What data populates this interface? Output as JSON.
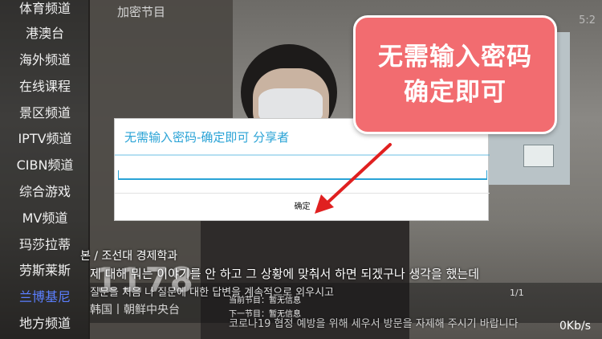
{
  "sidebar": {
    "items": [
      {
        "label": "体育频道"
      },
      {
        "label": "港澳台"
      },
      {
        "label": "海外频道"
      },
      {
        "label": "在线课程"
      },
      {
        "label": "景区频道"
      },
      {
        "label": "IPTV频道"
      },
      {
        "label": "CIBN频道"
      },
      {
        "label": "综合游戏"
      },
      {
        "label": "MV频道"
      },
      {
        "label": "玛莎拉蒂"
      },
      {
        "label": "劳斯莱斯"
      },
      {
        "label": "兰博基尼",
        "active": true
      },
      {
        "label": "地方频道"
      }
    ]
  },
  "program_list": {
    "title": "加密节目"
  },
  "top_right": {
    "time": "5:2"
  },
  "callout": {
    "line1": "无需输入密码",
    "line2": "确定即可"
  },
  "dialog": {
    "title": "无需输入密码-确定即可 分享者",
    "input_value": "",
    "confirm_label": "确定"
  },
  "subtitles": {
    "line1": "본 / 조선대 경제학과",
    "line2": "제 대해 뭐는 이야기를 안 하고 그 상황에 맞춰서 하면 되겠구나 생각을 했는데",
    "line3": "질문을 처음 나 질문에 대한 답변을 계속적으로 외우시고",
    "line4": "코로나19 협정 예방을 위해 세우서 방문을 자제해 주시기 바랍니다"
  },
  "info_bar": {
    "channel_number": "1178",
    "channel_name": "韩国丨朝鲜中央台",
    "now_label": "当前节目：暂无信息",
    "next_label": "下一节目：暂无信息",
    "page": "1/1",
    "net_speed": "0Kb/s"
  },
  "colors": {
    "accent": "#2aa3d6",
    "callout_bg": "#f26c70",
    "active_channel": "#5b7fff",
    "arrow": "#e02020"
  }
}
